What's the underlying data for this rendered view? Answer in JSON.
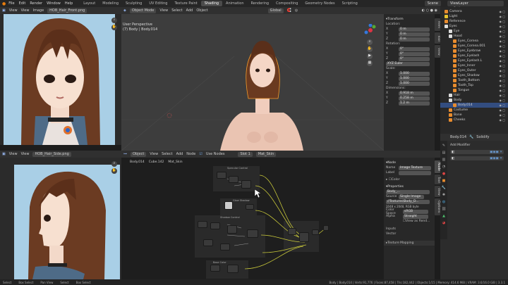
{
  "topbar": {
    "menu": [
      "File",
      "Edit",
      "Render",
      "Window",
      "Help"
    ],
    "workspaces": [
      "Layout",
      "Modeling",
      "Sculpting",
      "UV Editing",
      "Texture Paint",
      "Shading",
      "Animation",
      "Rendering",
      "Compositing",
      "Geometry Nodes",
      "Scripting"
    ],
    "active_workspace": "Shading",
    "scene": "Scene",
    "view_layer": "ViewLayer"
  },
  "image_editor_top": {
    "menu": [
      "View",
      "View",
      "Image"
    ],
    "image_name": "HOB_Hair_Front.png"
  },
  "image_editor_bottom": {
    "menu": [
      "View",
      "View"
    ],
    "image_name": "HOB_Hair_Side.png"
  },
  "viewport": {
    "mode": "Object Mode",
    "menu": [
      "View",
      "Select",
      "Add",
      "Object"
    ],
    "transform": "Global",
    "view_name": "User Perspective",
    "object_label": "(7) Body | Body.014",
    "options": "Options"
  },
  "n_panel": {
    "section": "Transform",
    "location_label": "Location:",
    "location": [
      {
        "axis": "X",
        "value": "0 m"
      },
      {
        "axis": "Y",
        "value": "0 m"
      },
      {
        "axis": "Z",
        "value": "0 m"
      }
    ],
    "rotation_label": "Rotation:",
    "rotation": [
      {
        "axis": "X",
        "value": "0°"
      },
      {
        "axis": "Y",
        "value": "0°"
      },
      {
        "axis": "Z",
        "value": "0°"
      }
    ],
    "euler": "XYZ Euler",
    "scale_label": "Scale:",
    "scale": [
      {
        "axis": "X",
        "value": "1.000"
      },
      {
        "axis": "Y",
        "value": "1.000"
      },
      {
        "axis": "Z",
        "value": "1.000"
      }
    ],
    "dimensions_label": "Dimensions:",
    "dimensions": [
      {
        "axis": "X",
        "value": "0.918 m"
      },
      {
        "axis": "Y",
        "value": "0.258 m"
      },
      {
        "axis": "Z",
        "value": "1.2 m"
      }
    ],
    "tabs": [
      "Item",
      "Tool",
      "View"
    ]
  },
  "outliner": {
    "rows": [
      "Camera",
      "Light",
      "Reference",
      "Eyes",
      "Eye",
      "Hood",
      "Eyes_Cornea",
      "Eyes_Cornea.001",
      "Eyes_Eyebrow",
      "Eyes_Eyelash",
      "Eyes_Eyelash.L",
      "Eyes_Inner",
      "Eyes_Outer",
      "Eyes_Shadow",
      "Tooth_Bottom",
      "Tooth_Top",
      "Tongue",
      "Hair",
      "Body",
      "Body.014",
      "Costume",
      "Bone",
      "Cheeks"
    ],
    "selected": "Body.014"
  },
  "modifier_panel": {
    "object": "Body.014",
    "modifier": "Solidify",
    "add_modifier": "Add Modifier"
  },
  "node_editor": {
    "menu": [
      "Object",
      "View",
      "Select",
      "Add",
      "Node"
    ],
    "use_nodes": "Use Nodes",
    "slot": "Slot 1",
    "material": "Mat_Skin",
    "breadcrumb": [
      "Body.014",
      "Cube.142",
      "Mat_Skin"
    ],
    "frames": [
      "Specular Control",
      "Glow Shadow",
      "Shadow Control",
      "Base Color"
    ]
  },
  "node_sidebar": {
    "section": "Node",
    "name_label": "Name",
    "name_value": "Image Texture",
    "label_label": "Label",
    "color_label": "Color",
    "properties_label": "Properties",
    "image_name": "Body_...",
    "source_label": "Source",
    "source_value": "Single Image",
    "filepath": "//Textures\\Body_D...",
    "resolution": "2048 x 2048, RGB byte",
    "colorspace_label": "Color Space",
    "colorspace_value": "sRGB",
    "alpha_label": "Alpha",
    "alpha_value": "Straight",
    "view_as_render": "View as Rend...",
    "inputs_label": "Inputs",
    "vector_label": "Vector",
    "texture_mapping": "Texture Mapping",
    "tabs": [
      "Node",
      "Tool",
      "View",
      "Options"
    ]
  },
  "statusbar": {
    "left": [
      "Select",
      "Box Select",
      "Pan View",
      "Select",
      "Box Select"
    ],
    "right": "Body | Body.014 | Verts:91,776 | Faces:87,458 | Tris:182,442 | Objects:1/15 | Memory: 414.6 MiB | VRAM: 3.6/16.0 GiB | 3.3.1"
  }
}
